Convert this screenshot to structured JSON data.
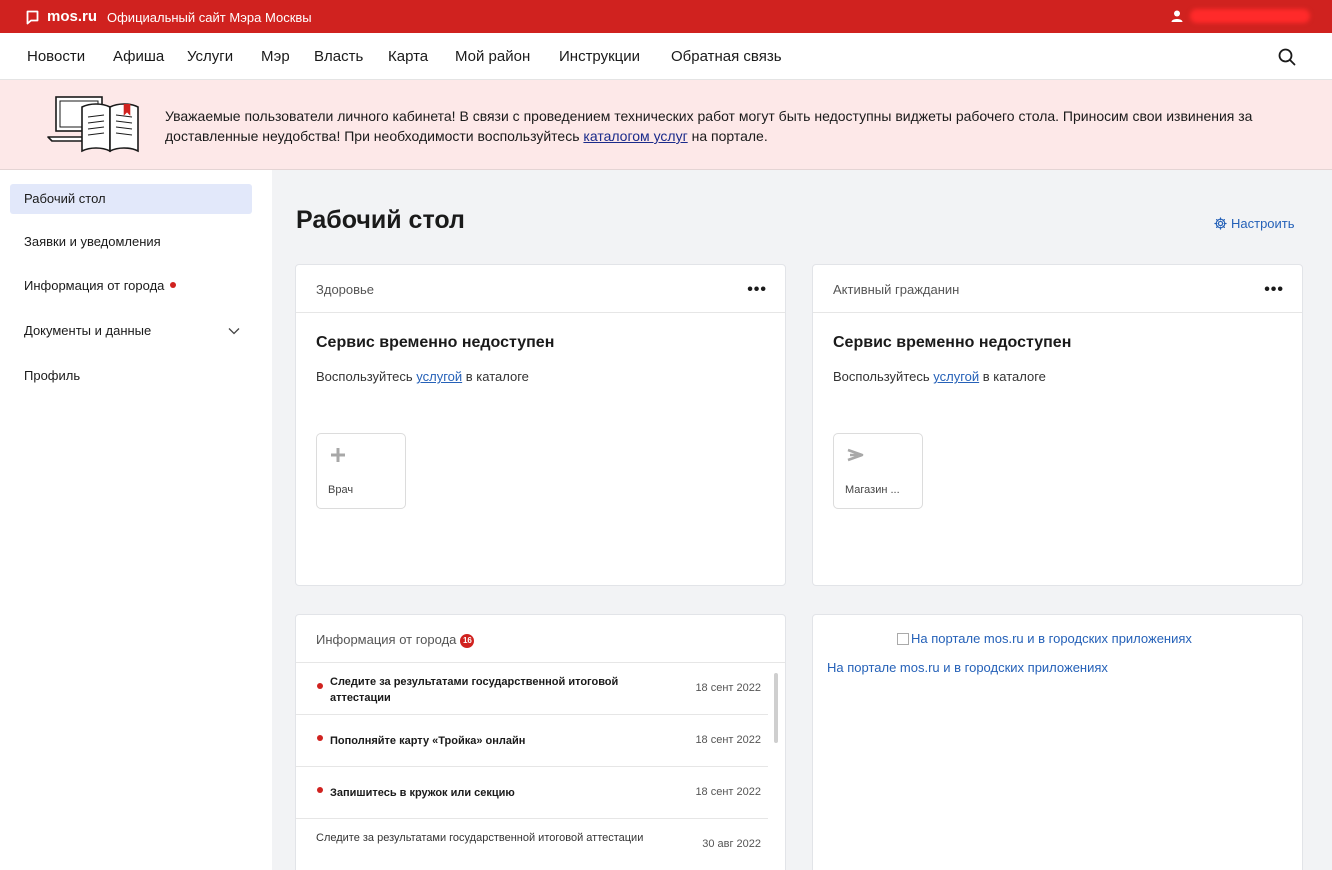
{
  "topbar": {
    "logo": "mos.ru",
    "site_title": "Официальный сайт Мэра Москвы"
  },
  "nav": {
    "items": [
      "Новости",
      "Афиша",
      "Услуги",
      "Мэр",
      "Власть",
      "Карта",
      "Мой район",
      "Инструкции",
      "Обратная связь"
    ]
  },
  "alert": {
    "text_before": "Уважаемые пользователи личного кабинета! В связи с проведением технических работ могут быть недоступны виджеты рабочего стола. Приносим свои извинения за доставленные неудобства! При необходимости воспользуйтесь ",
    "link": "каталогом услуг",
    "text_after": " на портале."
  },
  "sidebar": {
    "items": [
      {
        "label": "Рабочий стол"
      },
      {
        "label": "Заявки и уведомления"
      },
      {
        "label": "Информация от города"
      },
      {
        "label": "Документы и данные"
      },
      {
        "label": "Профиль"
      }
    ]
  },
  "main": {
    "title": "Рабочий стол",
    "configure": "Настроить",
    "health": {
      "title": "Здоровье",
      "heading": "Сервис временно недоступен",
      "sub_before": "Воспользуйтесь ",
      "sub_link": "услугой",
      "sub_after": " в каталоге",
      "tile_label": "Врач"
    },
    "citizen": {
      "title": "Активный гражданин",
      "heading": "Сервис временно недоступен",
      "sub_before": "Воспользуйтесь ",
      "sub_link": "услугой",
      "sub_after": " в каталоге",
      "tile_label": "Магазин ..."
    },
    "city_info": {
      "title": "Информация от города",
      "badge": "16",
      "news": [
        {
          "text": "Следите за результатами государственной итоговой аттестации",
          "date": "18 сент 2022"
        },
        {
          "text": "Пополняйте карту «Тройка» онлайн",
          "date": "18 сент 2022"
        },
        {
          "text": "Запишитесь в кружок или секцию",
          "date": "18 сент 2022"
        },
        {
          "text": "Следите за результатами государственной итоговой аттестации",
          "date": "30 авг 2022"
        }
      ]
    },
    "promo": {
      "img_alt": "На портале mos.ru и в городских приложениях",
      "link": "На портале mos.ru и в городских приложениях"
    }
  }
}
